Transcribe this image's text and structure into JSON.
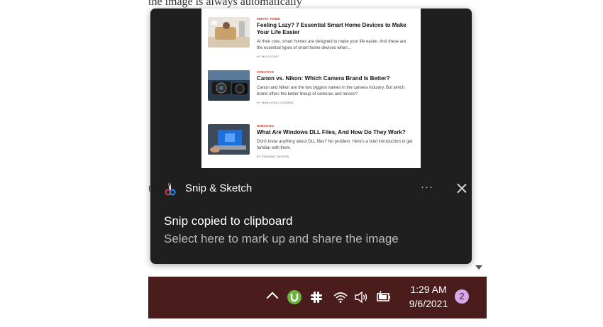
{
  "background": {
    "heading_fragment": "the image is always automatically",
    "letters": [
      "t",
      "t"
    ]
  },
  "toast": {
    "app_name": "Snip & Sketch",
    "more_label": "···",
    "title": "Snip copied to clipboard",
    "subtitle": "Select here to mark up and share the image"
  },
  "preview": {
    "articles": [
      {
        "category": "SMART HOME",
        "title": "Feeling Lazy? 7 Essential Smart Home Devices to Make Your Life Easier",
        "description": "At their core, smart homes are designed to make your life easier. And these are the essential types of smart home devices when...",
        "author": "BY MUO STAFF"
      },
      {
        "category": "CREATIVE",
        "title": "Canon vs. Nikon: Which Camera Brand Is Better?",
        "description": "Canon and Nikon are the two biggest names in the camera industry. But which brand offers the better lineup of cameras and lenses?",
        "author": "BY MANUVIRAJ GODARA"
      },
      {
        "category": "WINDOWS",
        "title": "What Are Windows DLL Files, And How Do They Work?",
        "description": "Don't know anything about DLL files? No problem. Here's a brief introduction to get familiar with them.",
        "author": "BY PRASANT MISHRA"
      }
    ]
  },
  "taskbar": {
    "time": "1:29 AM",
    "date": "9/6/2021",
    "notification_count": "2",
    "tray_icons": [
      "chevron-up-icon",
      "utorrent-icon",
      "slack-icon",
      "wifi-icon",
      "volume-icon",
      "battery-charging-icon"
    ]
  },
  "colors": {
    "toast_bg": "#1f1f1f",
    "taskbar_bg": "#4a1c1c",
    "badge_bg": "#d8a7e8",
    "category_red": "#c0392b",
    "utorrent_green": "#6cb33f"
  }
}
